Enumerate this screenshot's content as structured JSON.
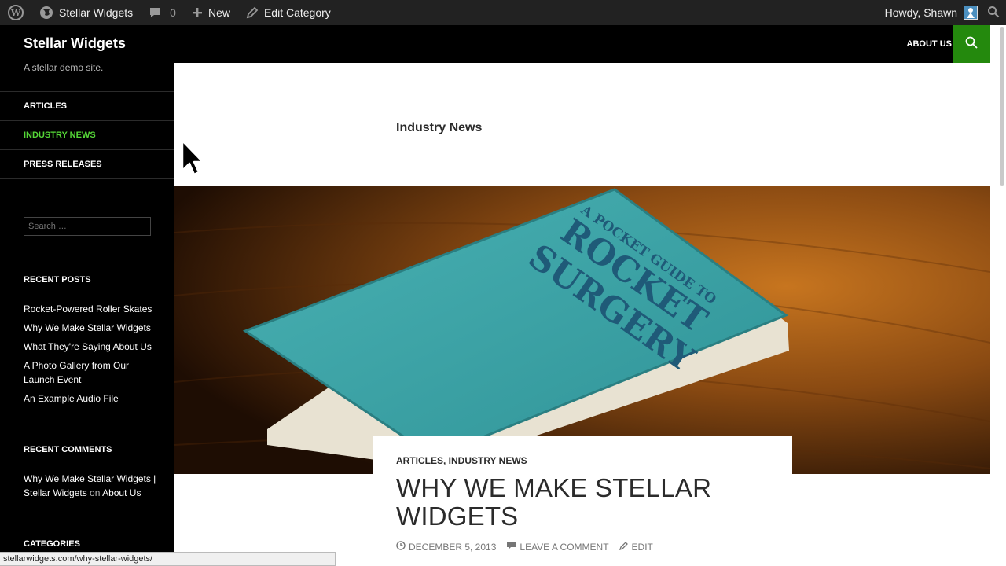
{
  "adminbar": {
    "site_name": "Stellar Widgets",
    "comments_count": "0",
    "new_label": "New",
    "edit_label": "Edit Category",
    "greeting": "Howdy, Shawn"
  },
  "header": {
    "site_title": "Stellar Widgets",
    "tagline": "A stellar demo site.",
    "nav": [
      {
        "label": "ABOUT US"
      }
    ]
  },
  "sidebar": {
    "menu": [
      {
        "label": "ARTICLES",
        "current": false
      },
      {
        "label": "INDUSTRY NEWS",
        "current": true
      },
      {
        "label": "PRESS RELEASES",
        "current": false
      }
    ],
    "search_placeholder": "Search …",
    "recent_posts_title": "RECENT POSTS",
    "recent_posts": [
      {
        "label": "Rocket-Powered Roller Skates"
      },
      {
        "label": "Why We Make Stellar Widgets"
      },
      {
        "label": "What They're Saying About Us"
      },
      {
        "label": "A Photo Gallery from Our Launch Event"
      },
      {
        "label": "An Example Audio File"
      }
    ],
    "recent_comments_title": "RECENT COMMENTS",
    "recent_comment": {
      "post": "Why We Make Stellar Widgets | Stellar Widgets",
      "on": "on",
      "target": "About Us"
    },
    "categories_title": "CATEGORIES"
  },
  "main": {
    "archive_title": "Industry News",
    "featured_book": {
      "line1": "A POCKET GUIDE TO",
      "line2": "ROCKET",
      "line3": "SURGERY"
    },
    "post": {
      "cat1": "ARTICLES",
      "sep": ", ",
      "cat2": "INDUSTRY NEWS",
      "title": "WHY WE MAKE STELLAR WIDGETS",
      "date": "DECEMBER 5, 2013",
      "comment_link": "LEAVE A COMMENT",
      "edit_link": "EDIT"
    }
  },
  "statusbar": {
    "url": "stellarwidgets.com/why-stellar-widgets/"
  },
  "colors": {
    "accent": "#24890d",
    "current_menu": "#55d737",
    "adminbar": "#222222"
  }
}
